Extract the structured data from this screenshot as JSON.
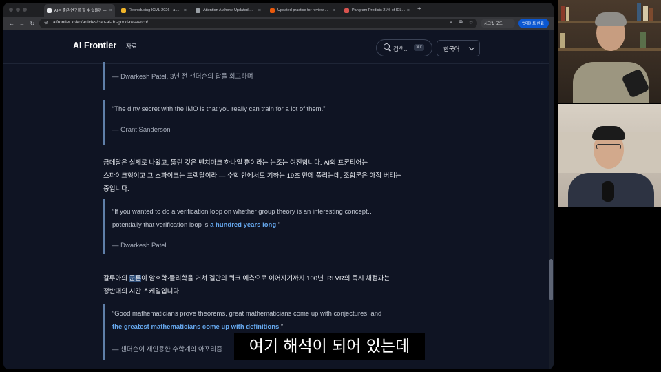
{
  "tabs": [
    {
      "title": "AI는 좋은 연구를 할 수 있을까 — ...",
      "favicon_color": "#e8eaed",
      "active": true
    },
    {
      "title": "Reproducing ICML 2026 - a ...",
      "favicon_color": "#f0b429",
      "active": false
    },
    {
      "title": "Attention Authors: Updated ...",
      "favicon_color": "#9aa0a6",
      "active": false
    },
    {
      "title": "Updated practice for review ...",
      "favicon_color": "#e8590c",
      "active": false
    },
    {
      "title": "Pangram Predicts 21% of ICL...",
      "favicon_color": "#d9534f",
      "active": false
    }
  ],
  "toolbar": {
    "url": "aifrontier.kr/ko/articles/can-ai-do-good-research/",
    "secret_mode": "시크릿 모드",
    "update": "업데이트 완료"
  },
  "site": {
    "logo": "AI Frontier",
    "nav_resources": "자료",
    "search_label": "검색...",
    "search_shortcut": "⌘K",
    "language": "한국어"
  },
  "content": {
    "q0_attr": "— Dwarkesh Patel, 3년 전 샌더슨의 답을 회고하며",
    "q1_text": "“The dirty secret with the IMO is that you really can train for a lot of them.”",
    "q1_attr": "— Grant Sanderson",
    "p1_line1": "금메달은 실제로 나왔고, 뚫린 것은 벤치마크 하나일 뿐이라는 논조는 여전합니다. AI의 프론티어는",
    "p1_line2": "스파이크형이고 그 스파이크는 프랙탈이라 — 수학 안에서도 기하는 19초 만에 풀리는데, 조합론은 아직 버티는",
    "p1_line3": "중입니다.",
    "q2_line1": "“If you wanted to do a verification loop on whether group theory is an interesting concept…",
    "q2_line2_pre": "potentially that verification loop is ",
    "q2_line2_hl": "a hundred years long",
    "q2_line2_post": ".”",
    "q2_attr": "— Dwarkesh Patel",
    "p2_line1_pre": "갈루아의 ",
    "p2_line1_sel": "군론",
    "p2_line1_post": "이 암호학·물리학을 거쳐 겔만의 쿼크 예측으로 이어지기까지 100년. RLVR의 즉시 채점과는",
    "p2_line2": "정반대의 시간 스케일입니다.",
    "q3_line1": "“Good mathematicians prove theorems, great mathematicians come up with conjectures, and",
    "q3_line2_hl": "the greatest mathematicians come up with definitions",
    "q3_line2_post": ".”",
    "q3_attr": "— 샌더슨이 재인용한 수학계의 아포리즘"
  },
  "subtitle": "여기 해석이 되어 있는데",
  "colors": {
    "page_bg": "#0f1423",
    "quote_bar": "#5f7fa8",
    "highlight": "#66a8ee",
    "body_text": "#eaedf2"
  }
}
